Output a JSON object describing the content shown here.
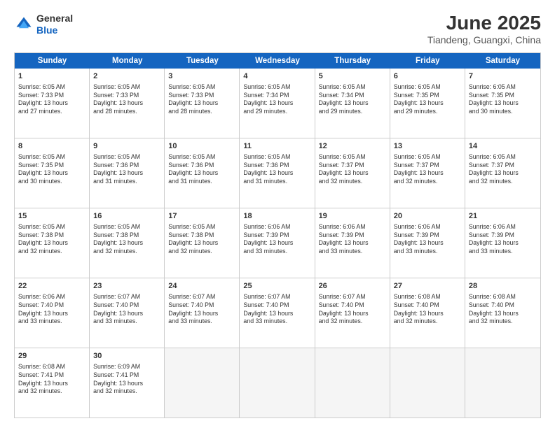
{
  "header": {
    "logo": {
      "line1": "General",
      "line2": "Blue"
    },
    "title": "June 2025",
    "location": "Tiandeng, Guangxi, China"
  },
  "days_of_week": [
    "Sunday",
    "Monday",
    "Tuesday",
    "Wednesday",
    "Thursday",
    "Friday",
    "Saturday"
  ],
  "rows": [
    {
      "cells": [
        {
          "day": "1",
          "lines": [
            "Sunrise: 6:05 AM",
            "Sunset: 7:33 PM",
            "Daylight: 13 hours",
            "and 27 minutes."
          ]
        },
        {
          "day": "2",
          "lines": [
            "Sunrise: 6:05 AM",
            "Sunset: 7:33 PM",
            "Daylight: 13 hours",
            "and 28 minutes."
          ]
        },
        {
          "day": "3",
          "lines": [
            "Sunrise: 6:05 AM",
            "Sunset: 7:33 PM",
            "Daylight: 13 hours",
            "and 28 minutes."
          ]
        },
        {
          "day": "4",
          "lines": [
            "Sunrise: 6:05 AM",
            "Sunset: 7:34 PM",
            "Daylight: 13 hours",
            "and 29 minutes."
          ]
        },
        {
          "day": "5",
          "lines": [
            "Sunrise: 6:05 AM",
            "Sunset: 7:34 PM",
            "Daylight: 13 hours",
            "and 29 minutes."
          ]
        },
        {
          "day": "6",
          "lines": [
            "Sunrise: 6:05 AM",
            "Sunset: 7:35 PM",
            "Daylight: 13 hours",
            "and 29 minutes."
          ]
        },
        {
          "day": "7",
          "lines": [
            "Sunrise: 6:05 AM",
            "Sunset: 7:35 PM",
            "Daylight: 13 hours",
            "and 30 minutes."
          ]
        }
      ]
    },
    {
      "cells": [
        {
          "day": "8",
          "lines": [
            "Sunrise: 6:05 AM",
            "Sunset: 7:35 PM",
            "Daylight: 13 hours",
            "and 30 minutes."
          ]
        },
        {
          "day": "9",
          "lines": [
            "Sunrise: 6:05 AM",
            "Sunset: 7:36 PM",
            "Daylight: 13 hours",
            "and 31 minutes."
          ]
        },
        {
          "day": "10",
          "lines": [
            "Sunrise: 6:05 AM",
            "Sunset: 7:36 PM",
            "Daylight: 13 hours",
            "and 31 minutes."
          ]
        },
        {
          "day": "11",
          "lines": [
            "Sunrise: 6:05 AM",
            "Sunset: 7:36 PM",
            "Daylight: 13 hours",
            "and 31 minutes."
          ]
        },
        {
          "day": "12",
          "lines": [
            "Sunrise: 6:05 AM",
            "Sunset: 7:37 PM",
            "Daylight: 13 hours",
            "and 32 minutes."
          ]
        },
        {
          "day": "13",
          "lines": [
            "Sunrise: 6:05 AM",
            "Sunset: 7:37 PM",
            "Daylight: 13 hours",
            "and 32 minutes."
          ]
        },
        {
          "day": "14",
          "lines": [
            "Sunrise: 6:05 AM",
            "Sunset: 7:37 PM",
            "Daylight: 13 hours",
            "and 32 minutes."
          ]
        }
      ]
    },
    {
      "cells": [
        {
          "day": "15",
          "lines": [
            "Sunrise: 6:05 AM",
            "Sunset: 7:38 PM",
            "Daylight: 13 hours",
            "and 32 minutes."
          ]
        },
        {
          "day": "16",
          "lines": [
            "Sunrise: 6:05 AM",
            "Sunset: 7:38 PM",
            "Daylight: 13 hours",
            "and 32 minutes."
          ]
        },
        {
          "day": "17",
          "lines": [
            "Sunrise: 6:05 AM",
            "Sunset: 7:38 PM",
            "Daylight: 13 hours",
            "and 32 minutes."
          ]
        },
        {
          "day": "18",
          "lines": [
            "Sunrise: 6:06 AM",
            "Sunset: 7:39 PM",
            "Daylight: 13 hours",
            "and 33 minutes."
          ]
        },
        {
          "day": "19",
          "lines": [
            "Sunrise: 6:06 AM",
            "Sunset: 7:39 PM",
            "Daylight: 13 hours",
            "and 33 minutes."
          ]
        },
        {
          "day": "20",
          "lines": [
            "Sunrise: 6:06 AM",
            "Sunset: 7:39 PM",
            "Daylight: 13 hours",
            "and 33 minutes."
          ]
        },
        {
          "day": "21",
          "lines": [
            "Sunrise: 6:06 AM",
            "Sunset: 7:39 PM",
            "Daylight: 13 hours",
            "and 33 minutes."
          ]
        }
      ]
    },
    {
      "cells": [
        {
          "day": "22",
          "lines": [
            "Sunrise: 6:06 AM",
            "Sunset: 7:40 PM",
            "Daylight: 13 hours",
            "and 33 minutes."
          ]
        },
        {
          "day": "23",
          "lines": [
            "Sunrise: 6:07 AM",
            "Sunset: 7:40 PM",
            "Daylight: 13 hours",
            "and 33 minutes."
          ]
        },
        {
          "day": "24",
          "lines": [
            "Sunrise: 6:07 AM",
            "Sunset: 7:40 PM",
            "Daylight: 13 hours",
            "and 33 minutes."
          ]
        },
        {
          "day": "25",
          "lines": [
            "Sunrise: 6:07 AM",
            "Sunset: 7:40 PM",
            "Daylight: 13 hours",
            "and 33 minutes."
          ]
        },
        {
          "day": "26",
          "lines": [
            "Sunrise: 6:07 AM",
            "Sunset: 7:40 PM",
            "Daylight: 13 hours",
            "and 32 minutes."
          ]
        },
        {
          "day": "27",
          "lines": [
            "Sunrise: 6:08 AM",
            "Sunset: 7:40 PM",
            "Daylight: 13 hours",
            "and 32 minutes."
          ]
        },
        {
          "day": "28",
          "lines": [
            "Sunrise: 6:08 AM",
            "Sunset: 7:40 PM",
            "Daylight: 13 hours",
            "and 32 minutes."
          ]
        }
      ]
    },
    {
      "cells": [
        {
          "day": "29",
          "lines": [
            "Sunrise: 6:08 AM",
            "Sunset: 7:41 PM",
            "Daylight: 13 hours",
            "and 32 minutes."
          ]
        },
        {
          "day": "30",
          "lines": [
            "Sunrise: 6:09 AM",
            "Sunset: 7:41 PM",
            "Daylight: 13 hours",
            "and 32 minutes."
          ]
        },
        {
          "day": "",
          "lines": []
        },
        {
          "day": "",
          "lines": []
        },
        {
          "day": "",
          "lines": []
        },
        {
          "day": "",
          "lines": []
        },
        {
          "day": "",
          "lines": []
        }
      ]
    }
  ]
}
